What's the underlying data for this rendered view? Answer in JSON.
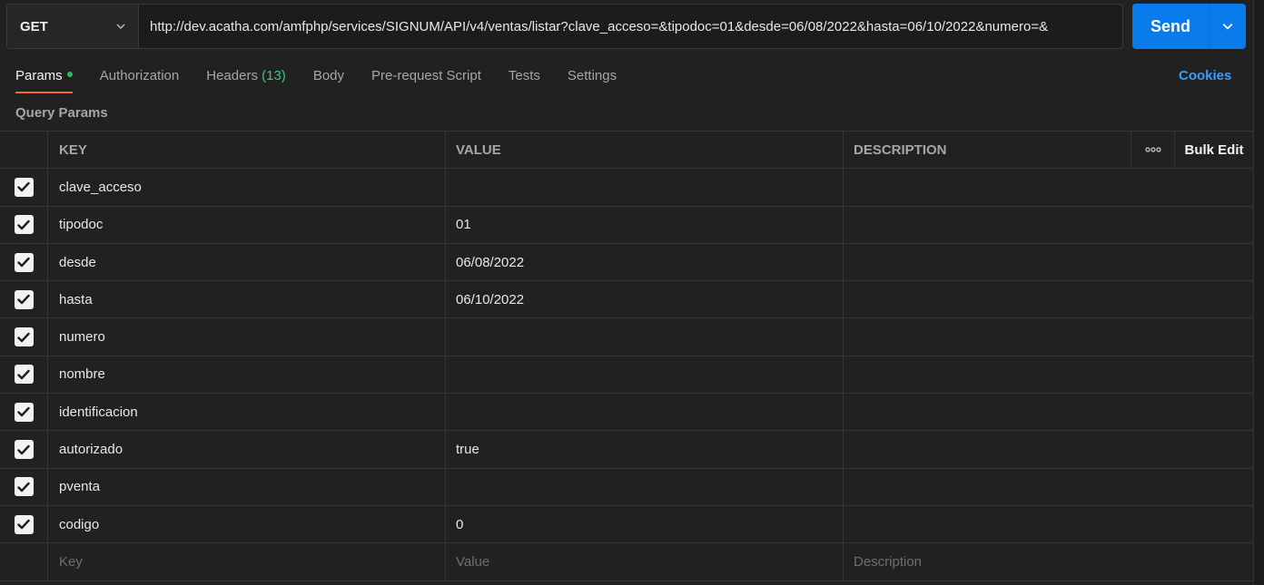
{
  "request": {
    "method": "GET",
    "url": "http://dev.acatha.com/amfphp/services/SIGNUM/API/v4/ventas/listar?clave_acceso=&tipodoc=01&desde=06/08/2022&hasta=06/10/2022&numero=&"
  },
  "send": {
    "label": "Send"
  },
  "tabs": [
    {
      "label": "Params",
      "active": true
    },
    {
      "label": "Authorization"
    },
    {
      "label": "Headers",
      "count": "(13)"
    },
    {
      "label": "Body"
    },
    {
      "label": "Pre-request Script"
    },
    {
      "label": "Tests"
    },
    {
      "label": "Settings"
    }
  ],
  "cookies_label": "Cookies",
  "query_params_title": "Query Params",
  "table": {
    "headers": {
      "key": "KEY",
      "value": "VALUE",
      "description": "DESCRIPTION",
      "bulk_edit": "Bulk Edit"
    },
    "rows": [
      {
        "key": "clave_acceso",
        "value": "",
        "description": "",
        "checked": true
      },
      {
        "key": "tipodoc",
        "value": "01",
        "description": "",
        "checked": true
      },
      {
        "key": "desde",
        "value": "06/08/2022",
        "description": "",
        "checked": true
      },
      {
        "key": "hasta",
        "value": "06/10/2022",
        "description": "",
        "checked": true
      },
      {
        "key": "numero",
        "value": "",
        "description": "",
        "checked": true
      },
      {
        "key": "nombre",
        "value": "",
        "description": "",
        "checked": true
      },
      {
        "key": "identificacion",
        "value": "",
        "description": "",
        "checked": true
      },
      {
        "key": "autorizado",
        "value": "true",
        "description": "",
        "checked": true
      },
      {
        "key": "pventa",
        "value": "",
        "description": "",
        "checked": true
      },
      {
        "key": "codigo",
        "value": "0",
        "description": "",
        "checked": true
      }
    ],
    "placeholders": {
      "key": "Key",
      "value": "Value",
      "description": "Description"
    }
  },
  "colors": {
    "accent": "#097bed",
    "active_tab_underline": "#f26b3a",
    "dot": "#2bb96a",
    "link": "#3b9cf5"
  },
  "icons": {
    "method_dropdown": "chevron-down-icon",
    "send_dropdown": "chevron-down-icon",
    "more": "more-horizontal-icon",
    "check": "check-icon"
  }
}
